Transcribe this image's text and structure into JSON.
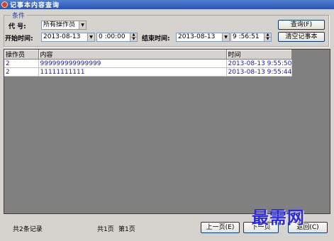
{
  "window": {
    "title": "记事本内容查询"
  },
  "conditions": {
    "group_caption": "条件",
    "code_label": "代 号:",
    "operator_select": "所有操作员",
    "start_label": "开始时间:",
    "start_date": "2013-08-13",
    "start_time": "0 :00:00",
    "end_label": "结束时间:",
    "end_date": "2013-08-13",
    "end_time": "9 :56:51"
  },
  "buttons": {
    "query": "查询(F)",
    "clear_notes": "清空记事本",
    "prev_page": "上一页(E)",
    "next_page": "下一页",
    "back": "返回(C)"
  },
  "table": {
    "columns": [
      "操作员",
      "内容",
      "时间"
    ],
    "rows": [
      [
        "2",
        "999999999999999",
        "2013-08-13 9:55:50"
      ],
      [
        "2",
        "11111111111",
        "2013-08-13 9:55:44"
      ]
    ]
  },
  "status": {
    "total_records": "共2条记录",
    "total_pages": "共1页",
    "current_page": "第1页"
  },
  "watermark": "最需网",
  "icons": {
    "window": "app-icon",
    "dropdown": "chevron-down-icon",
    "spinner": "spin-arrows-icon"
  }
}
